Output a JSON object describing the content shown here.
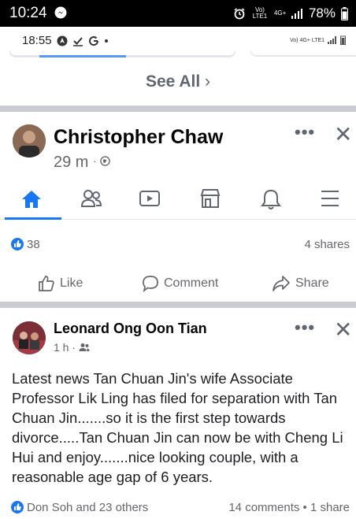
{
  "status_bar": {
    "time": "10:24",
    "battery": "78%",
    "network": "4G+",
    "carrier": "Vo) LTE1"
  },
  "inner_status": {
    "time": "18:55",
    "icons": [
      "nav-icon",
      "check-icon",
      "google-icon",
      "dot-icon"
    ],
    "network": "Vo) 4G+ LTE1"
  },
  "see_all": {
    "label": "See All",
    "chevron": "›"
  },
  "post1": {
    "author": "Christopher Chaw",
    "time": "29 m",
    "privacy_icon": "globe-icon",
    "more": "•••",
    "close": "✕",
    "nav_items": [
      "home-icon",
      "friends-icon",
      "watch-icon",
      "marketplace-icon",
      "notifications-icon",
      "menu-icon"
    ],
    "reactions_count": "38",
    "shares": "4 shares",
    "actions": {
      "like": "Like",
      "comment": "Comment",
      "share": "Share"
    }
  },
  "post2": {
    "author": "Leonard Ong Oon Tian",
    "time": "1 h",
    "audience_icon": "friends-icon",
    "more": "•••",
    "close": "✕",
    "body": "Latest news Tan Chuan Jin's wife Associate Professor Lik Ling has filed for separation with Tan Chuan Jin.......so it is the first step towards divorce.....Tan Chuan Jin can now be with Cheng Li Hui and enjoy.......nice looking couple, with a reasonable age gap of 6 years.",
    "reactions": "Don Soh and 23 others",
    "comments_shares": "14 comments • 1 share"
  },
  "colors": {
    "accent": "#1877f2",
    "separator": "#c9ccd1",
    "muted": "#65676b"
  }
}
